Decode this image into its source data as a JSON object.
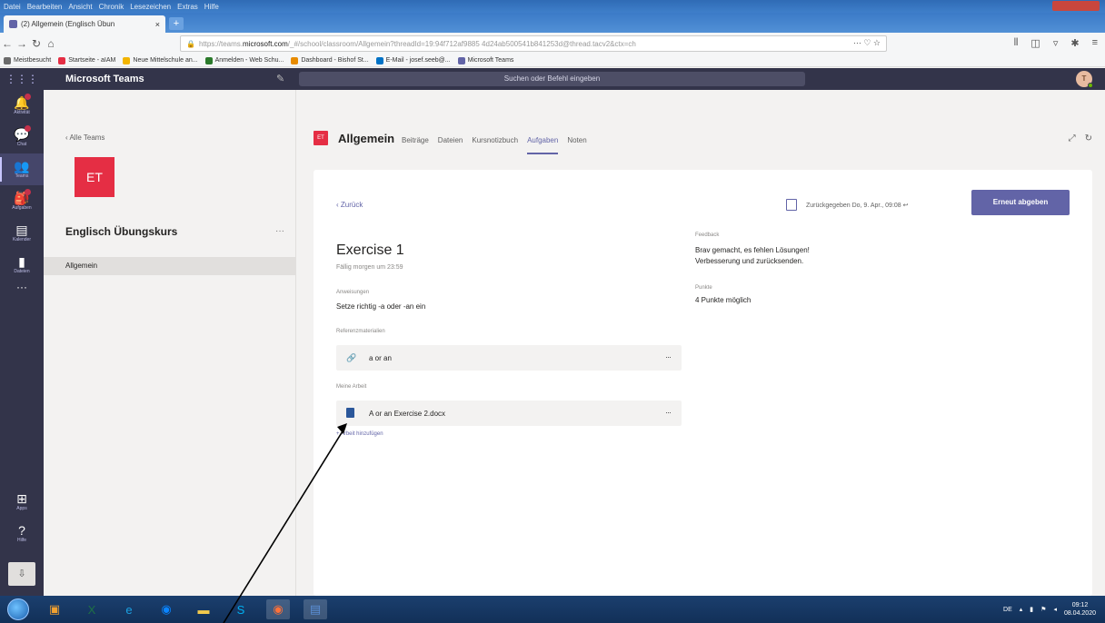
{
  "browser": {
    "menu": [
      "Datei",
      "Bearbeiten",
      "Ansicht",
      "Chronik",
      "Lesezeichen",
      "Extras",
      "Hilfe"
    ],
    "tab_title": "(2) Allgemein (Englisch Übun",
    "tab_close": "×",
    "new_tab": "+",
    "url_prefix": "https://teams.",
    "url_host": "microsoft.com",
    "url_rest": "/_#/school/classroom/Allgemein?threadId=19:94f712af9885 4d24ab500541b841253d@thread.tacv2&ctx=ch",
    "url_actions": "··· ♡ ☆",
    "bookmarks": [
      {
        "label": "Meistbesucht",
        "color": "#6b6b6b"
      },
      {
        "label": "Startseite - aIAM",
        "color": "#e52e44"
      },
      {
        "label": "Neue Mittelschule an...",
        "color": "#f2b400"
      },
      {
        "label": "Anmelden - Web Schu...",
        "color": "#2b7a2b"
      },
      {
        "label": "Dashboard - Bishof St...",
        "color": "#e88b00"
      },
      {
        "label": "E-Mail - josef.seeb@...",
        "color": "#0072c6"
      },
      {
        "label": "Microsoft Teams",
        "color": "#6264a7"
      }
    ]
  },
  "teams": {
    "app_title": "Microsoft Teams",
    "search_placeholder": "Suchen oder Befehl eingeben",
    "user_initial": "T",
    "appbar": [
      {
        "icon": "bell-icon",
        "glyph": "🔔",
        "label": "Aktivität",
        "badge": true
      },
      {
        "icon": "chat-icon",
        "glyph": "💬",
        "label": "Chat",
        "badge": true
      },
      {
        "icon": "teams-icon",
        "glyph": "👥",
        "label": "Teams",
        "badge": false,
        "active": true
      },
      {
        "icon": "assignments-icon",
        "glyph": "🎒",
        "label": "Aufgaben",
        "badge": true
      },
      {
        "icon": "calendar-icon",
        "glyph": "▤",
        "label": "Kalender",
        "badge": false
      },
      {
        "icon": "files-icon",
        "glyph": "▮",
        "label": "Dateien",
        "badge": false
      }
    ],
    "appbar_more": "···",
    "appbar_bottom": [
      {
        "icon": "apps-icon",
        "glyph": "⊞",
        "label": "Apps"
      },
      {
        "icon": "help-icon",
        "glyph": "?",
        "label": "Hilfe"
      }
    ],
    "download_glyph": "⇩"
  },
  "team_panel": {
    "back": "‹  Alle Teams",
    "logo": "ET",
    "team_name": "Englisch Übungskurs",
    "more": "···",
    "channel": "Allgemein"
  },
  "channel": {
    "avatar": "ET",
    "title": "Allgemein",
    "tabs": [
      "Beiträge",
      "Dateien",
      "Kursnotizbuch",
      "Aufgaben",
      "Noten"
    ],
    "active_tab": "Aufgaben",
    "actions": [
      "⤢",
      "↻"
    ]
  },
  "assignment": {
    "back": "‹  Zurück",
    "turned_in": "Zurückgegeben Do, 9. Apr., 09:08 ↩",
    "resubmit": "Erneut abgeben",
    "title": "Exercise 1",
    "due": "Fällig morgen um 23:59",
    "instructions_label": "Anweisungen",
    "instructions": "Setze richtig -a oder -an ein",
    "reference_label": "Referenzmaterialien",
    "reference_item": "a or an",
    "my_work_label": "Meine Arbeit",
    "my_work_item": "A or an Exercise 2.docx",
    "row_more": "···",
    "add_work": "+ Arbeit hinzufügen",
    "feedback_label": "Feedback",
    "feedback_line1": "Brav gemacht, es fehlen Lösungen!",
    "feedback_line2": "Verbesserung und zurücksenden.",
    "points_label": "Punkte",
    "points": "4 Punkte möglich"
  },
  "taskbar": {
    "apps": [
      {
        "icon": "media-center-icon",
        "glyph": "▣",
        "color": "#f0a030"
      },
      {
        "icon": "excel-icon",
        "glyph": "X",
        "color": "#1e7145"
      },
      {
        "icon": "ie-icon",
        "glyph": "e",
        "color": "#1ba1e2"
      },
      {
        "icon": "firefox-dev-icon",
        "glyph": "◉",
        "color": "#0a84ff"
      },
      {
        "icon": "explorer-icon",
        "glyph": "▬",
        "color": "#f2c94c"
      },
      {
        "icon": "skype-icon",
        "glyph": "S",
        "color": "#00aff0"
      },
      {
        "icon": "firefox-icon",
        "glyph": "◉",
        "color": "#ff7139"
      },
      {
        "icon": "document-icon",
        "glyph": "▤",
        "color": "#5b8fd6"
      }
    ],
    "tray_lang": "DE",
    "time": "09:12",
    "date": "08.04.2020"
  }
}
